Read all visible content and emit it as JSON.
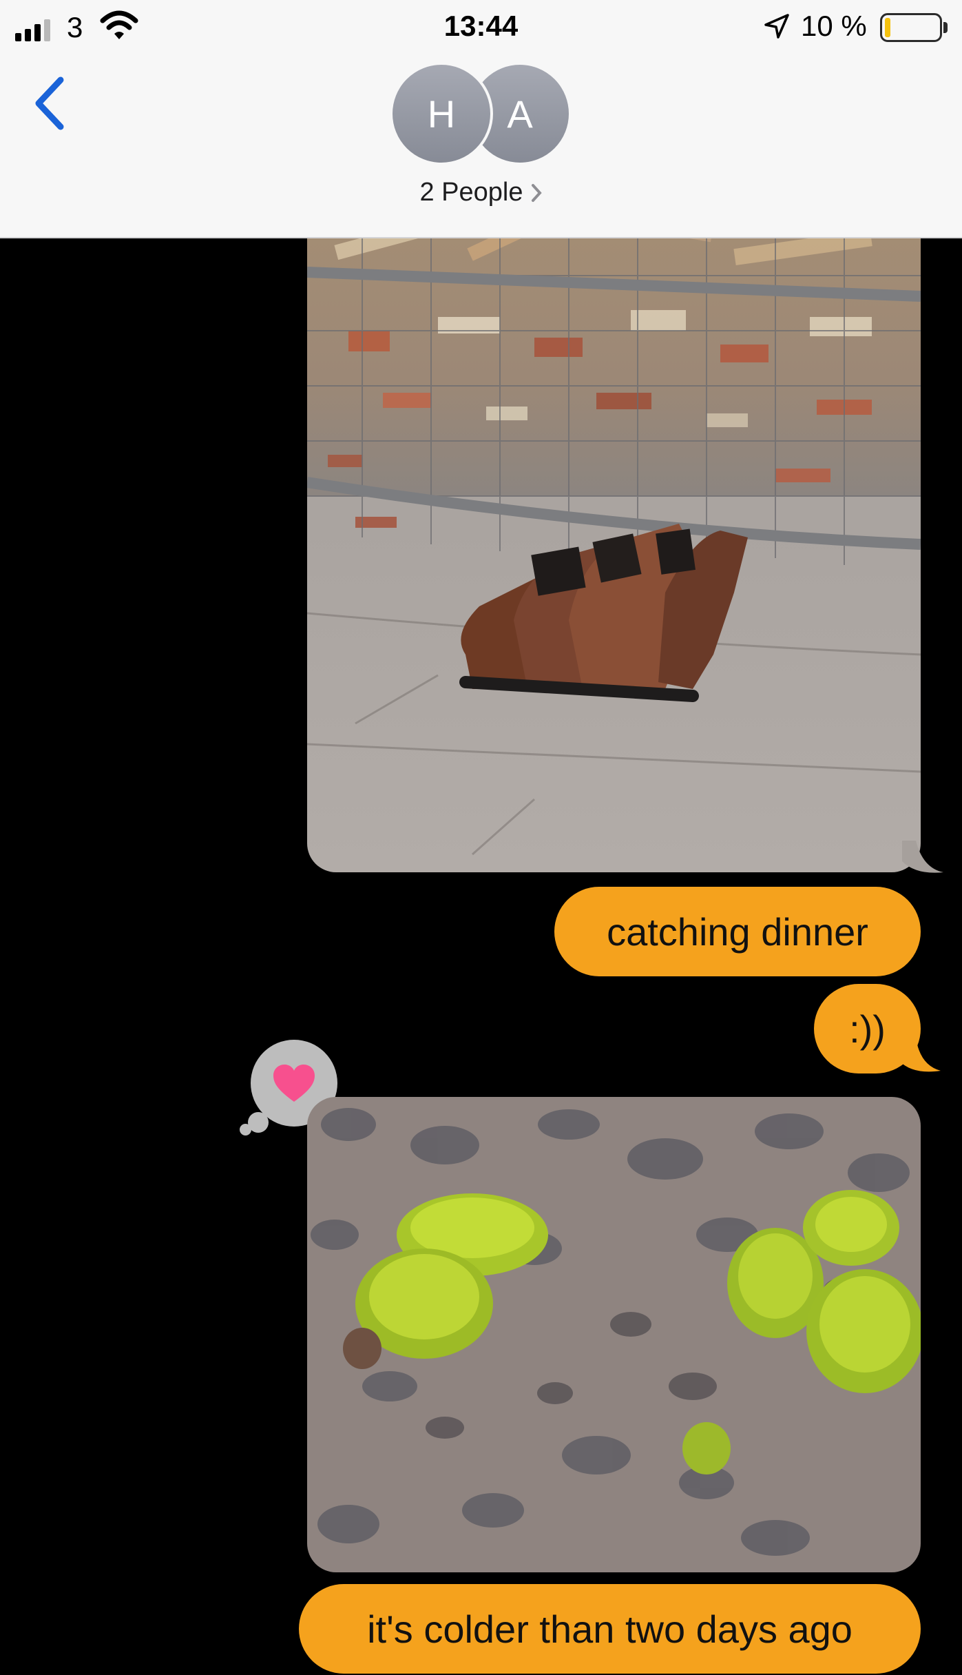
{
  "status_bar": {
    "carrier": "3",
    "time": "13:44",
    "battery_percent": "10 %",
    "battery_level": 0.1,
    "icons": [
      "signal-icon",
      "wifi-icon",
      "location-arrow-icon",
      "battery-icon"
    ]
  },
  "header": {
    "avatars": [
      "H",
      "A"
    ],
    "people_label": "2 People",
    "back_icon": "chevron-left-icon",
    "disclosure_icon": "chevron-right-icon"
  },
  "messages": [
    {
      "type": "image",
      "sender": "me",
      "description_icon": "photo"
    },
    {
      "type": "text",
      "sender": "me",
      "text": "catching dinner"
    },
    {
      "type": "text",
      "sender": "me",
      "text": ":))"
    },
    {
      "type": "image",
      "sender": "me",
      "reaction": "heart-icon"
    },
    {
      "type": "text",
      "sender": "me",
      "text": "it's colder than two days ago"
    }
  ],
  "colors": {
    "bubble": "#f5a21d",
    "background": "#000000",
    "header": "#f7f7f7",
    "accent_blue": "#1a63d8",
    "reaction_heart": "#f7508e"
  }
}
